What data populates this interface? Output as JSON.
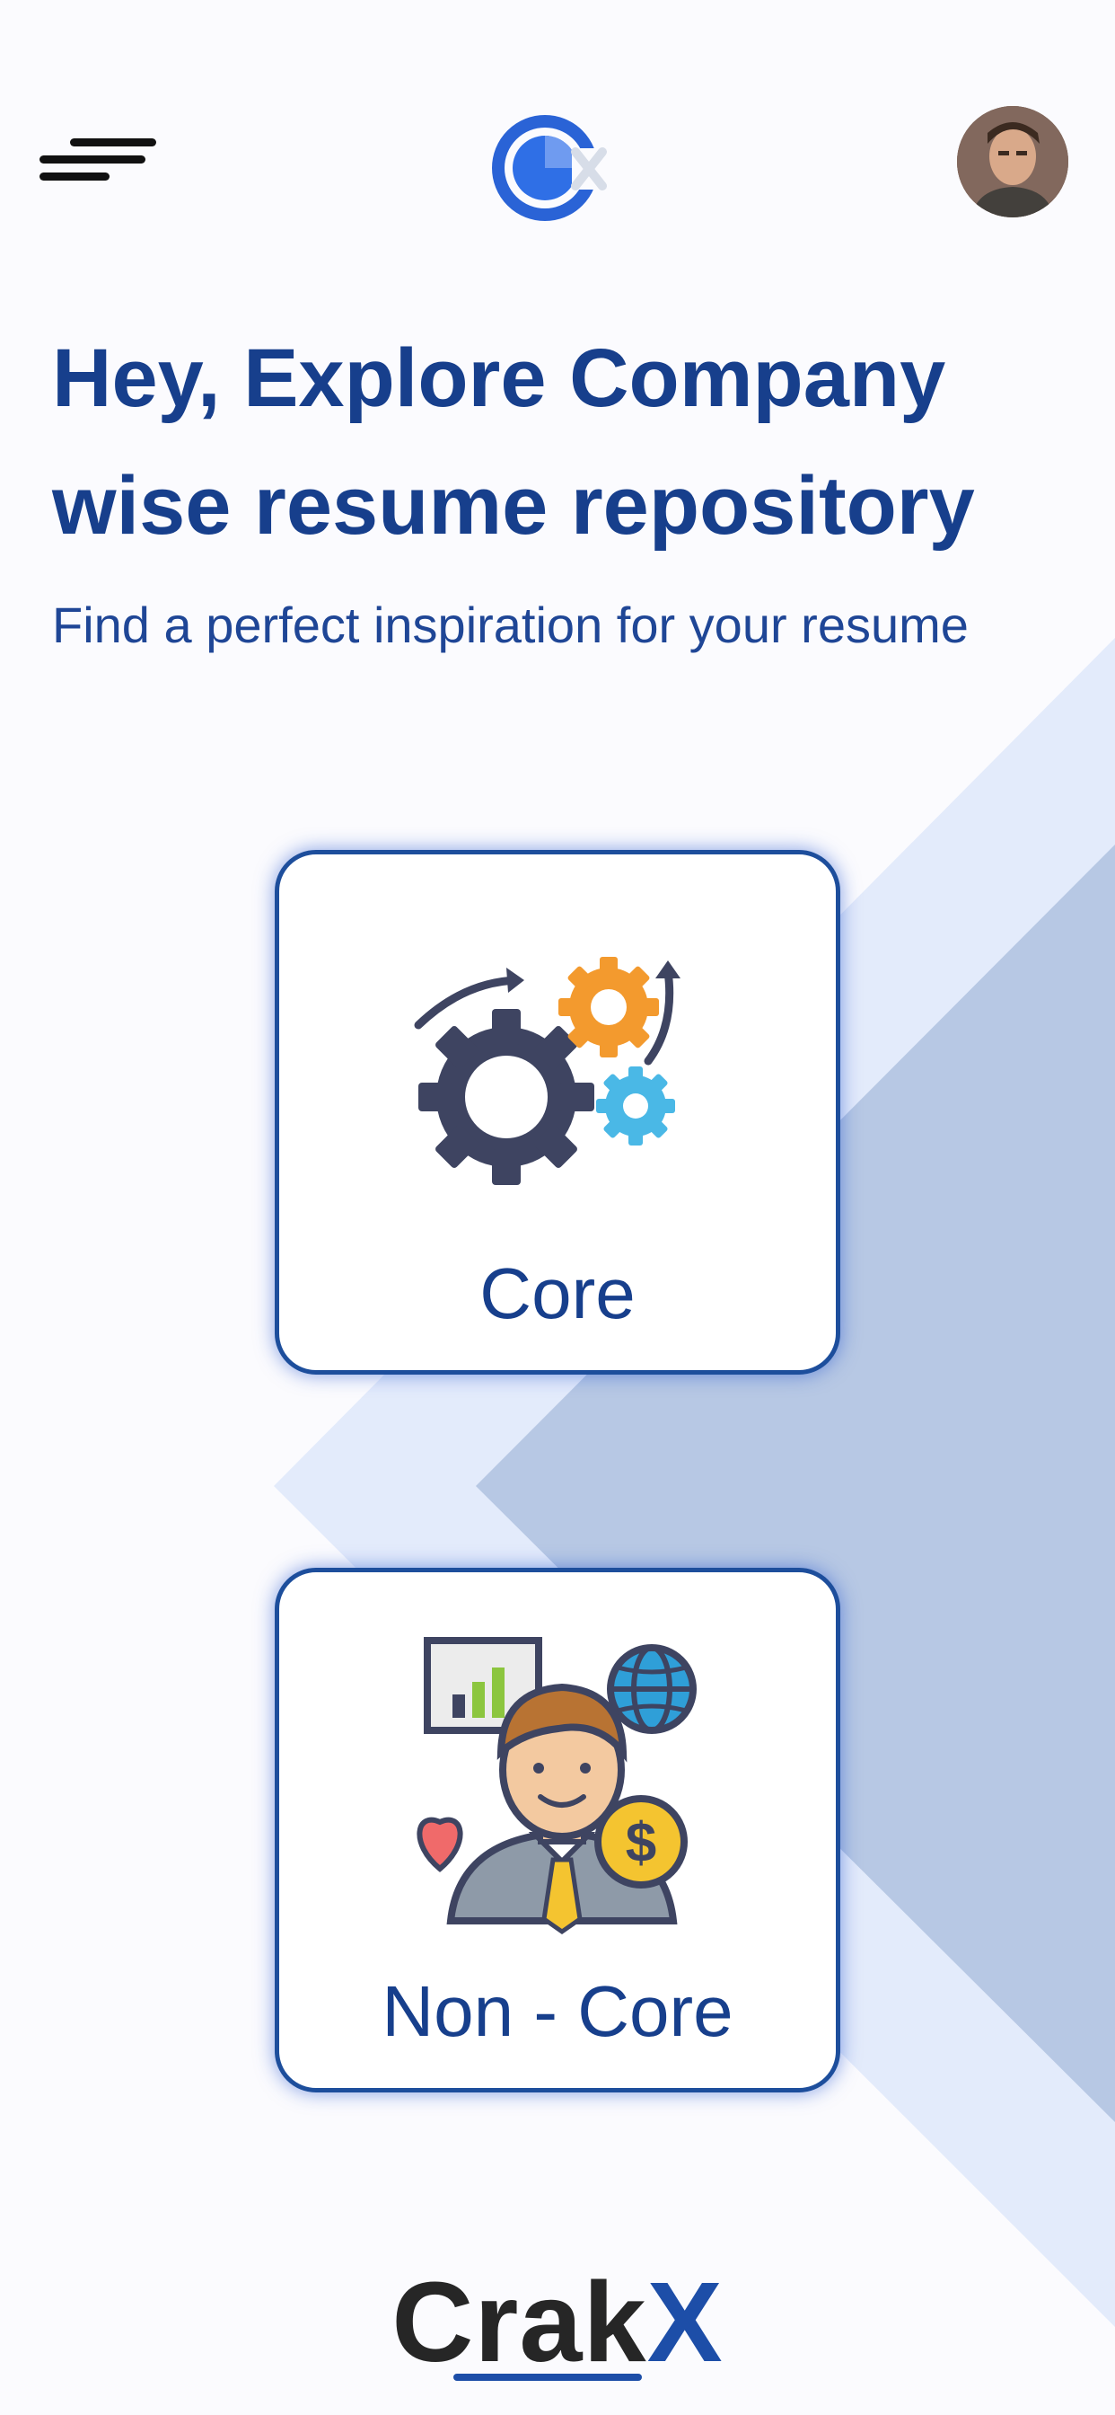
{
  "header": {
    "menu_icon": "menu-icon",
    "logo_icon": "cx-logo",
    "avatar_icon": "user-avatar"
  },
  "hero": {
    "title": "Hey, Explore Company wise resume repository",
    "subtitle": "Find a perfect inspiration for your resume"
  },
  "categories": [
    {
      "label": "Core",
      "icon": "gears-icon"
    },
    {
      "label": "Non - Core",
      "icon": "businessman-icon"
    }
  ],
  "brand": {
    "crak": "Crak",
    "x": "X"
  },
  "colors": {
    "primary_text": "#173f8c",
    "accent": "#1d4e9c",
    "background_shape_light": "#e3ebfb",
    "background_shape_dark": "#b7c8e4"
  }
}
